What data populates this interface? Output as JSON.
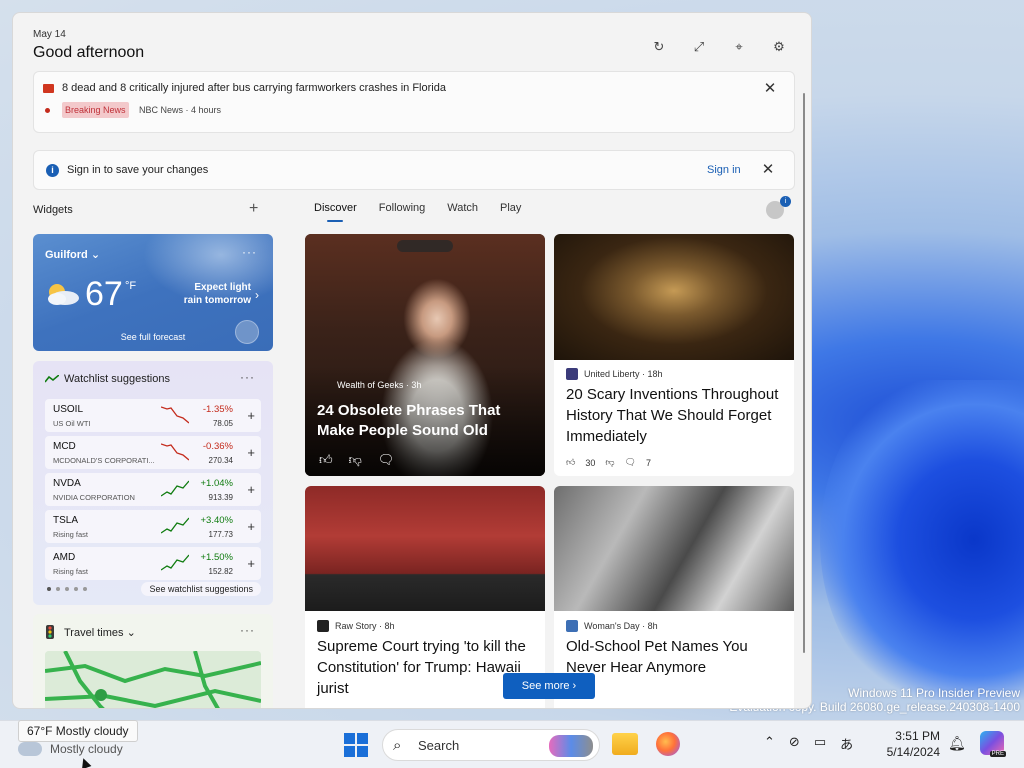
{
  "panel": {
    "date": "May 14",
    "greeting": "Good afternoon"
  },
  "breaking": {
    "headline": "8 dead and 8 critically injured after bus carrying farmworkers crashes in Florida",
    "badge": "Breaking News",
    "source": "NBC News · 4 hours"
  },
  "signin_bar": {
    "message": "Sign in to save your changes",
    "link": "Sign in"
  },
  "widgets": {
    "title": "Widgets",
    "add": "+"
  },
  "weather": {
    "location": "Guilford",
    "temp": "67",
    "unit": "°F",
    "summary": "Expect light rain tomorrow",
    "forecast_link": "See full forecast"
  },
  "watchlist": {
    "title": "Watchlist suggestions",
    "see_all": "See watchlist suggestions",
    "stocks": [
      {
        "symbol": "USOIL",
        "name": "US Oil WTI",
        "change": "-1.35%",
        "price": "78.05",
        "trend": "down"
      },
      {
        "symbol": "MCD",
        "name": "MCDONALD'S CORPORATI...",
        "change": "-0.36%",
        "price": "270.34",
        "trend": "down"
      },
      {
        "symbol": "NVDA",
        "name": "NVIDIA CORPORATION",
        "change": "+1.04%",
        "price": "913.39",
        "trend": "up"
      },
      {
        "symbol": "TSLA",
        "name": "Rising fast",
        "change": "+3.40%",
        "price": "177.73",
        "trend": "up"
      },
      {
        "symbol": "AMD",
        "name": "Rising fast",
        "change": "+1.50%",
        "price": "152.82",
        "trend": "up"
      }
    ]
  },
  "travel": {
    "title": "Travel times"
  },
  "feed": {
    "tabs": [
      "Discover",
      "Following",
      "Watch",
      "Play"
    ],
    "articles": [
      {
        "source": "Wealth of Geeks · 3h",
        "headline": "24 Obsolete Phrases That Make People Sound Old"
      },
      {
        "source": "United Liberty · 18h",
        "headline": "20 Scary Inventions Throughout History That We Should Forget Immediately",
        "likes": "30",
        "comments": "7"
      },
      {
        "source": "Raw Story · 8h",
        "headline": "Supreme Court trying 'to kill the Constitution' for Trump: Hawaii jurist"
      },
      {
        "source": "Woman's Day · 8h",
        "headline": "Old-School Pet Names You Never Hear Anymore"
      }
    ],
    "see_more": "See more"
  },
  "desktop": {
    "eval_line1": "Windows 11 Pro Insider Preview",
    "eval_line2": "Evaluation copy. Build 26080.ge_release.240308-1400"
  },
  "taskbar": {
    "tooltip": "67°F Mostly cloudy",
    "weather_text": "Mostly cloudy",
    "search_placeholder": "Search",
    "time": "3:51 PM",
    "date": "5/14/2024",
    "copilot_badge": "PRE"
  },
  "colors": {
    "accent": "#1a5fb4",
    "negative": "#c42b1c",
    "positive": "#107c10",
    "breaking": "#c0323a"
  }
}
